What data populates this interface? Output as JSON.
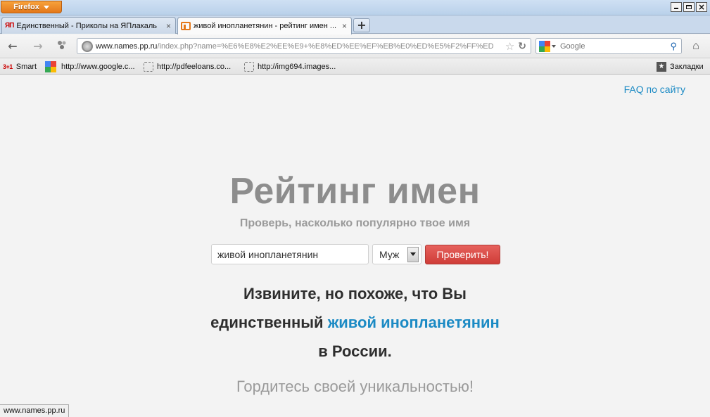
{
  "browser": {
    "menu_button": "Firefox",
    "window_controls": {
      "minimize": "",
      "maximize": "",
      "close": "×"
    }
  },
  "tabs": [
    {
      "favicon_text": "ЯП",
      "label": "Единственный - Приколы на ЯПлакаль",
      "close": "×"
    },
    {
      "favicon_text": "",
      "label": "живой инопланетянин - рейтинг имен ...",
      "close": "×"
    }
  ],
  "new_tab": "+",
  "navbar": {
    "url_host": "www.names.pp.ru",
    "url_rest": "/index.php?name=%E6%E8%E2%EE%E9+%E8%ED%EE%EF%EB%E0%ED%E5%F2%FF%ED",
    "search_placeholder": "Google",
    "back": "←",
    "forward": "→",
    "reload": "↻",
    "star": "☆",
    "search_icon": "⚲",
    "home": "⌂"
  },
  "bookmarks": [
    {
      "icon_text": "3+1",
      "label": "Smart"
    },
    {
      "icon_text": "",
      "label": "http://www.google.c..."
    },
    {
      "icon_text": "",
      "label": "http://pdfeeloans.co..."
    },
    {
      "icon_text": "",
      "label": "http://img694.images..."
    }
  ],
  "bookmarks_menu": {
    "label": "Закладки",
    "icon_text": "★"
  },
  "page": {
    "faq_link": "FAQ по сайту",
    "title": "Рейтинг имен",
    "subtitle": "Проверь, насколько популярно твое имя",
    "name_value": "живой инопланетянин",
    "gender_value": "Муж",
    "check_button": "Проверить!",
    "result_line1": "Извините, но похоже, что Вы",
    "result_line2_pre": "единственный",
    "result_name": "живой инопланетянин",
    "result_line3": "в России.",
    "proud_text": "Гордитесь своей уникальностью!"
  },
  "status_bar": "www.names.pp.ru",
  "colors": {
    "accent_link": "#1b8ac4",
    "button_red": "#d9443f",
    "title_gray": "#8d8d8d",
    "firefox_orange": "#e4781a"
  }
}
